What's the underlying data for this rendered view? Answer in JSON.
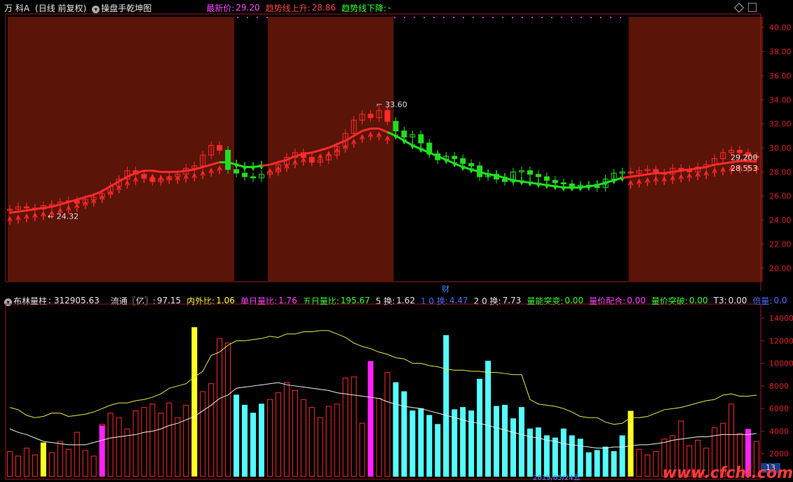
{
  "header_top": {
    "stock_name": "万 科A",
    "period": "(日线 前复权)",
    "indicator_name": "操盘手乾坤图",
    "latest_price_label": "最新价:",
    "latest_price": "29.20",
    "uptrend_label": "趋势线上升:",
    "uptrend_value": "28.86",
    "downtrend_label": "趋势线下降:",
    "downtrend_value": "-"
  },
  "price_axis": {
    "ticks": [
      "40.00",
      "38.00",
      "36.00",
      "34.00",
      "32.00",
      "30.00",
      "28.00",
      "26.00",
      "24.00",
      "22.00",
      "20.00"
    ],
    "min": 19.0,
    "max": 41.0
  },
  "annotations": {
    "low_label": "24.32",
    "high_label": "33.60",
    "right_price1": "29.200",
    "right_price2": "28.553",
    "cai_marker": "财"
  },
  "header_bottom": {
    "indicator_name": "布林量柱",
    "volume_value": ": 312905.63",
    "float_label": "流通〖亿〗:",
    "float_value": "97.15",
    "inout_label": "内外比:",
    "inout_value": "1.06",
    "single_label": "单日量比:",
    "single_value": "1.76",
    "five_label": "五日量比:",
    "five_value": "195.67",
    "turn5_label": "5 换:",
    "turn5_value": "1.62",
    "turn10_label": "1 0 换:",
    "turn10_value": "4.47",
    "turn20_label": "2 0 换:",
    "turn20_value": "7.73",
    "breakout_label": "量能突变:",
    "breakout_value": "0.00",
    "match_label": "量价配合:",
    "match_value": "0.00",
    "pv_break_label": "量价突破:",
    "pv_break_value": "0.00",
    "t3_label": "T3:",
    "t3_value": "0.00",
    "double_label": "倍量:",
    "double_value": "0.0"
  },
  "volume_axis": {
    "ticks": [
      "14000",
      "12000",
      "10000",
      "8000",
      "6000",
      "4000",
      "2000"
    ],
    "min": 0,
    "max": 15000
  },
  "footer": {
    "page_number": "13",
    "date_marker": "2019/05/24五",
    "watermark": "www.cfchi.com"
  },
  "colors": {
    "frame": "#9a1b1b",
    "zone": "#5a1408",
    "up": "#ff2a2a",
    "down": "#22dd22",
    "cyan": "#55ffff",
    "magenta": "#ff22ff",
    "yellow": "#ffff22"
  },
  "chart_data": {
    "type": "candlestick",
    "price_series": [
      24.9,
      25.1,
      25.0,
      24.9,
      25.2,
      25.3,
      25.5,
      25.6,
      25.4,
      25.7,
      25.9,
      26.2,
      26.8,
      27.4,
      28.1,
      27.8,
      27.5,
      27.2,
      27.4,
      27.6,
      27.8,
      28.3,
      28.5,
      29.4,
      30.2,
      29.8,
      28.2,
      27.9,
      27.6,
      27.5,
      27.8,
      28.0,
      28.6,
      29.2,
      29.6,
      29.2,
      28.8,
      29.0,
      29.4,
      30.1,
      31.2,
      32.3,
      32.8,
      32.5,
      33.1,
      32.2,
      31.4,
      30.9,
      31.1,
      30.4,
      29.5,
      29.0,
      29.3,
      29.1,
      28.7,
      28.5,
      27.6,
      27.8,
      27.4,
      27.2,
      28.0,
      28.1,
      27.8,
      27.6,
      27.3,
      27.1,
      27.0,
      26.8,
      26.9,
      26.8,
      26.7,
      27.4,
      27.9,
      28.0,
      27.9,
      28.1,
      28.2,
      27.9,
      27.8,
      28.3,
      28.2,
      28.0,
      28.4,
      28.6,
      29.1,
      29.6,
      29.8,
      29.6,
      29.3,
      29.2
    ],
    "trend_line": [
      24.6,
      24.7,
      24.8,
      24.9,
      25.0,
      25.1,
      25.3,
      25.5,
      25.7,
      25.9,
      26.1,
      26.4,
      26.8,
      27.2,
      27.6,
      27.9,
      28.1,
      28.1,
      28.0,
      28.0,
      28.0,
      28.1,
      28.2,
      28.4,
      28.6,
      28.8,
      28.8,
      28.6,
      28.4,
      28.4,
      28.5,
      28.6,
      28.8,
      29.0,
      29.3,
      29.5,
      29.6,
      29.8,
      30.0,
      30.3,
      30.6,
      31.0,
      31.4,
      31.6,
      31.6,
      31.3,
      31.0,
      30.6,
      30.2,
      29.9,
      29.6,
      29.3,
      29.0,
      28.7,
      28.4,
      28.2,
      28.0,
      27.8,
      27.7,
      27.5,
      27.3,
      27.2,
      27.1,
      27.0,
      26.9,
      26.8,
      26.7,
      26.7,
      26.7,
      26.8,
      26.9,
      27.1,
      27.3,
      27.5,
      27.6,
      27.7,
      27.8,
      27.9,
      27.9,
      28.0,
      28.1,
      28.2,
      28.3,
      28.4,
      28.6,
      28.7,
      28.8,
      28.9,
      28.9,
      28.86
    ],
    "zones": [
      [
        0,
        26
      ],
      [
        31,
        45
      ],
      [
        74,
        89
      ]
    ],
    "volume": [
      2200,
      1800,
      2500,
      1900,
      1600,
      2100,
      3100,
      2400,
      3900,
      2300,
      1800,
      4600,
      5600,
      5200,
      4200,
      5800,
      6100,
      6400,
      5600,
      6500,
      5200,
      6300,
      5800,
      7500,
      8200,
      12200,
      11800,
      7200,
      6300,
      5600,
      6400,
      6800,
      7400,
      8300,
      7600,
      6800,
      6100,
      5200,
      6200,
      6400,
      8700,
      8800,
      4700,
      6200,
      6900,
      9200,
      8300,
      7500,
      5800,
      6000,
      5400,
      4600,
      5100,
      5900,
      6100,
      5800,
      8600,
      10200,
      6200,
      6300,
      5100,
      6100,
      4200,
      4300,
      3600,
      3400,
      4200,
      3600,
      3300,
      2100,
      2300,
      2600,
      2200,
      3600,
      3900,
      2400,
      1900,
      2200,
      3300,
      3600,
      4900,
      2700,
      3200,
      2500,
      4300,
      4700,
      6400,
      3800,
      2900,
      3100
    ],
    "vol_upper": [
      6100,
      5900,
      5400,
      5200,
      5300,
      5600,
      5600,
      5300,
      5400,
      5500,
      5700,
      6000,
      6300,
      6500,
      6500,
      6700,
      6800,
      7000,
      7300,
      7800,
      8000,
      8200,
      8800,
      9300,
      10700,
      11000,
      11600,
      12000,
      12000,
      12100,
      12200,
      12400,
      12300,
      12600,
      12600,
      12800,
      12800,
      12900,
      12900,
      12600,
      12300,
      11800,
      11500,
      11300,
      11000,
      10800,
      10500,
      10400,
      10000,
      10000,
      9800,
      9700,
      9500,
      9400,
      9400,
      9300,
      9300,
      9200,
      9200,
      9100,
      9000,
      9000,
      6800,
      6400,
      6300,
      6200,
      6000,
      5700,
      5300,
      5200,
      5200,
      4800,
      4600,
      4700,
      5200,
      5200,
      5300,
      5600,
      5900,
      6000,
      6100,
      6300,
      6500,
      6700,
      6800,
      7200,
      7300,
      7100,
      7100,
      7200
    ],
    "vol_lower": [
      4200,
      3900,
      3700,
      3400,
      3100,
      3000,
      2900,
      2800,
      2800,
      2800,
      3000,
      3200,
      3400,
      3500,
      3600,
      3700,
      3900,
      4000,
      4200,
      4500,
      4700,
      5000,
      5300,
      5800,
      6300,
      6900,
      7200,
      7800,
      7900,
      8000,
      8100,
      8200,
      8300,
      8100,
      8000,
      7900,
      7800,
      7700,
      7600,
      7400,
      7300,
      7200,
      7100,
      7000,
      6900,
      6600,
      6400,
      6200,
      6100,
      6000,
      5800,
      5600,
      5400,
      5200,
      5000,
      4800,
      4700,
      4500,
      4300,
      4100,
      3900,
      3700,
      3500,
      3400,
      3200,
      3100,
      2900,
      2800,
      2700,
      2600,
      2500,
      2500,
      2600,
      2600,
      2700,
      2800,
      2800,
      2900,
      3000,
      3200,
      3300,
      3400,
      3500,
      3500,
      3600,
      3700,
      3700,
      3700,
      3700,
      3800
    ]
  }
}
